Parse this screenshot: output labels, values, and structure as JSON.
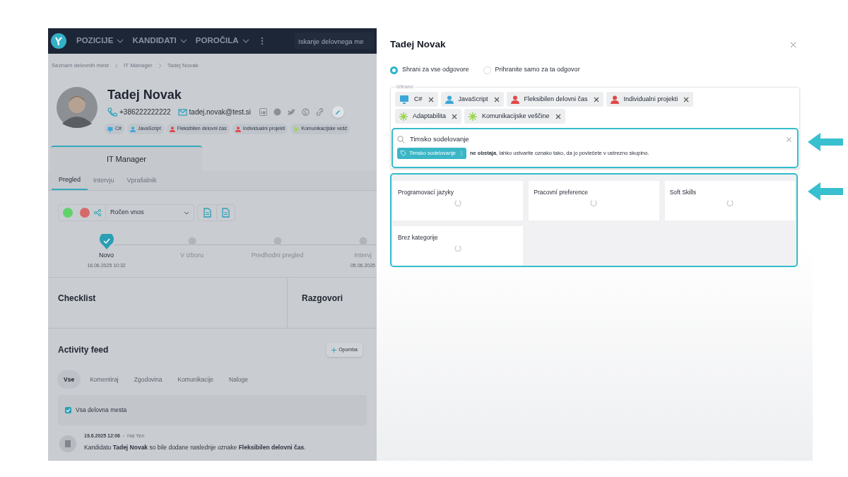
{
  "nav": {
    "items": [
      "POZICIJE",
      "KANDIDATI",
      "POROČILA"
    ],
    "search_placeholder": "Iskanje delovnega me"
  },
  "breadcrumb": [
    "Seznam delovnih mest",
    "IT Manager",
    "Tadej Novak"
  ],
  "candidate": {
    "name": "Tadej Novak",
    "phone": "+386222222222",
    "email": "tadej.novak@test.si",
    "tags": [
      {
        "label": "C#",
        "kind": "monitor",
        "color": "#3ba7d9"
      },
      {
        "label": "JavaScript",
        "kind": "person",
        "color": "#3ba7d9"
      },
      {
        "label": "Fleksibilen delovni čas",
        "kind": "person",
        "color": "#e04848"
      },
      {
        "label": "Individualni projekti",
        "kind": "person",
        "color": "#e04848"
      },
      {
        "label": "Komunikacijske vešč",
        "kind": "asterisk",
        "color": "#9bd34a"
      }
    ]
  },
  "job_tab": "IT Manager",
  "tabs": [
    {
      "label": "Pregled",
      "selected": true
    },
    {
      "label": "Intervju",
      "selected": false
    },
    {
      "label": "Vprašalnik",
      "selected": false
    }
  ],
  "toolbar": {
    "avatars": [
      {
        "color": "#5fd36a"
      },
      {
        "color": "#d66a6a"
      }
    ],
    "source": "Ročen vnos"
  },
  "pipeline": [
    {
      "label": "Novo",
      "date": "16.06.2025 10:32",
      "done": true
    },
    {
      "label": "V izboru",
      "done": false
    },
    {
      "label": "Predhodni pregled",
      "done": false
    },
    {
      "label": "Intervj",
      "date": "05.06.2025",
      "done": false
    }
  ],
  "sections": [
    "Checklist",
    "Razgovori"
  ],
  "activity": {
    "title": "Activity feed",
    "add_button": "Opomba",
    "filters": [
      {
        "label": "Vse",
        "selected": true
      },
      {
        "label": "Komentiraj",
        "selected": false
      },
      {
        "label": "Zgodovina",
        "selected": false
      },
      {
        "label": "Komunikacije",
        "selected": false
      },
      {
        "label": "Naloge",
        "selected": false
      }
    ],
    "all_jobs": {
      "label": "Vsa delovna mesta",
      "checked": true
    },
    "entry": {
      "time": "19.6.2025 12:06",
      "author": "Hai Yen",
      "text": "Kandidatu **Tadej Novak** so bile dodane naslednje oznake **Fleksibilen delovni čas**."
    }
  },
  "panel": {
    "title": "Tadej Novak",
    "radios": [
      {
        "label": "Shrani za vse odgovore",
        "selected": true
      },
      {
        "label": "Prihranite samo za ta odgovor",
        "selected": false
      }
    ],
    "selected_legend": "Izbrano:",
    "chips": [
      {
        "label": "C#",
        "kind": "monitor",
        "color": "#3ba7d9"
      },
      {
        "label": "JavaScript",
        "kind": "person",
        "color": "#3ba7d9"
      },
      {
        "label": "Fleksibilen delovni čas",
        "kind": "person",
        "color": "#e04848"
      },
      {
        "label": "Individualni projekti",
        "kind": "person",
        "color": "#e04848"
      },
      {
        "label": "Adaptabilita",
        "kind": "asterisk",
        "color": "#9bd34a"
      },
      {
        "label": "Komunikacijske veščine",
        "kind": "asterisk",
        "color": "#9bd34a"
      }
    ],
    "search_value": "Timsko sodelovanje",
    "new_tag": "Timsko sodelovanje",
    "new_tag_message": "**ne obstaja**, lahko ustvarite oznako tako, da jo povlečete v ustrezno skupino.",
    "categories": [
      "Programovací jazyky",
      "Pracovní preference",
      "Soft Skills",
      "Brez kategorije"
    ]
  }
}
